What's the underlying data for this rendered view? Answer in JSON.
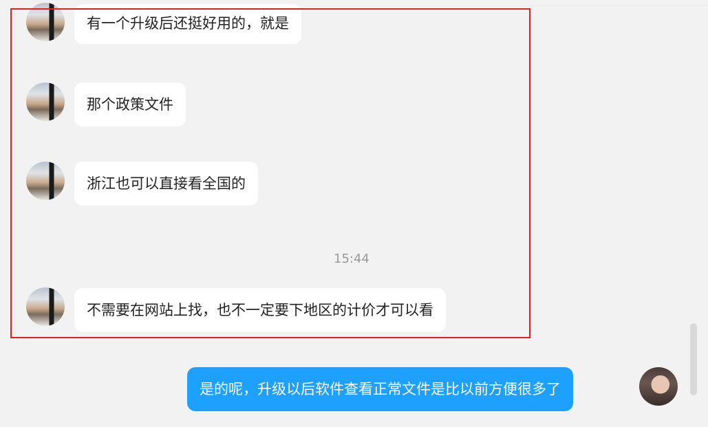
{
  "messages": [
    {
      "sender": "other",
      "text": "有一个升级后还挺好用的，就是"
    },
    {
      "sender": "other",
      "text": "那个政策文件"
    },
    {
      "sender": "other",
      "text": "浙江也可以直接看全国的"
    },
    {
      "sender": "other",
      "text": "不需要在网站上找，也不一定要下地区的计价才可以看"
    },
    {
      "sender": "me",
      "text": "是的呢，升级以后软件查看正常文件是比以前方便很多了"
    }
  ],
  "timestamp": "15:44",
  "colors": {
    "background": "#f2f2f2",
    "incoming_bubble": "#ffffff",
    "outgoing_bubble": "#1ea0ff",
    "highlight_border": "#e02020"
  }
}
